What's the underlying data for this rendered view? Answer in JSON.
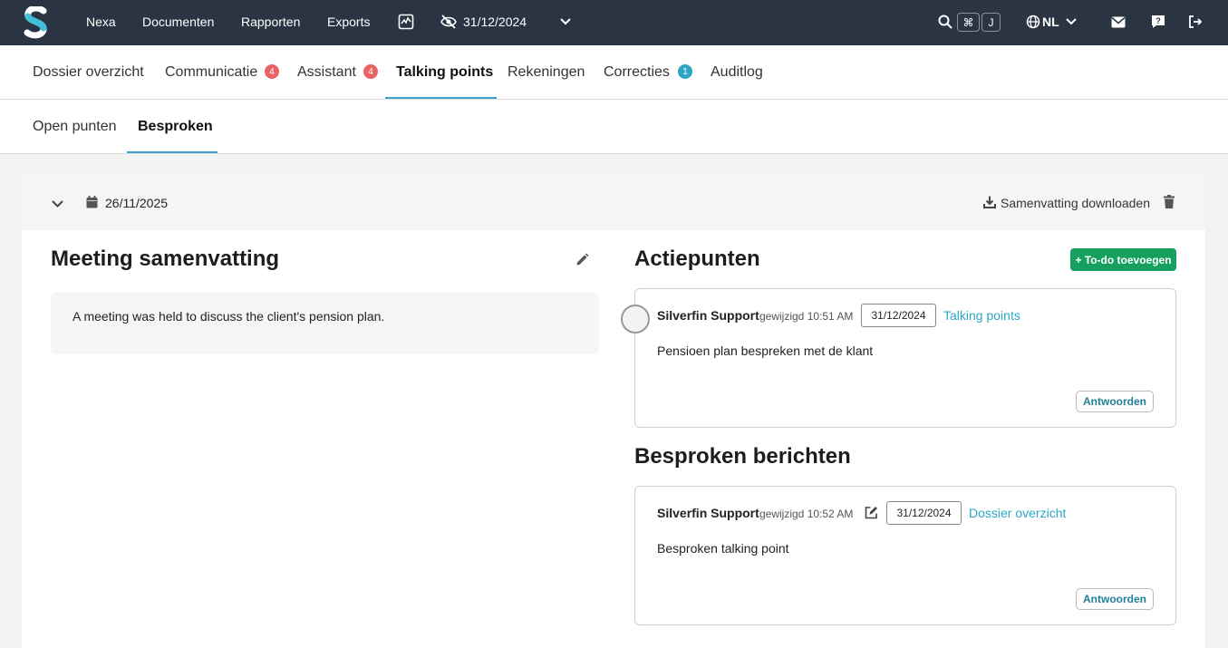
{
  "topnav": {
    "links": [
      "Nexa",
      "Documenten",
      "Rapporten",
      "Exports"
    ],
    "date": "31/12/2024",
    "shortcut_keys": [
      "⌘",
      "J"
    ],
    "language": "NL"
  },
  "tabs": [
    {
      "label": "Dossier overzicht",
      "badge": null
    },
    {
      "label": "Communicatie",
      "badge": "4"
    },
    {
      "label": "Assistant",
      "badge": "4"
    },
    {
      "label": "Talking points",
      "badge": null,
      "active": true
    },
    {
      "label": "Rekeningen",
      "badge": null
    },
    {
      "label": "Correcties",
      "badge": "1"
    },
    {
      "label": "Auditlog",
      "badge": null
    }
  ],
  "subtabs": [
    {
      "label": "Open punten"
    },
    {
      "label": "Besproken",
      "active": true
    }
  ],
  "meeting": {
    "date": "26/11/2025",
    "download_label": "Samenvatting downloaden",
    "summary_title": "Meeting samenvatting",
    "summary_text": "A meeting was held to discuss the client's pension plan."
  },
  "actions": {
    "title": "Actiepunten",
    "add_button": "+ To-do toevoegen",
    "items": [
      {
        "author": "Silverfin Support",
        "modified": "gewijzigd 10:51 AM",
        "date": "31/12/2024",
        "link": "Talking points",
        "text": "Pensioen plan bespreken met de klant",
        "reply": "Antwoorden"
      }
    ]
  },
  "discussed": {
    "title": "Besproken berichten",
    "items": [
      {
        "author": "Silverfin Support",
        "modified": "gewijzigd 10:52 AM",
        "date": "31/12/2024",
        "link": "Dossier overzicht",
        "text": "Besproken talking point",
        "reply": "Antwoorden"
      }
    ]
  },
  "colors": {
    "topbar": "#2a3442",
    "accent": "#2ba7c4",
    "badge_red": "#e86361",
    "add_button": "#16a05f"
  },
  "icons": [
    "logo-icon",
    "activity-chart-icon",
    "eye-off-icon",
    "chevron-down-icon",
    "search-icon",
    "globe-icon",
    "mail-icon",
    "help-icon",
    "logout-icon",
    "calendar-icon",
    "download-icon",
    "trash-icon",
    "pencil-icon",
    "edit-icon"
  ]
}
